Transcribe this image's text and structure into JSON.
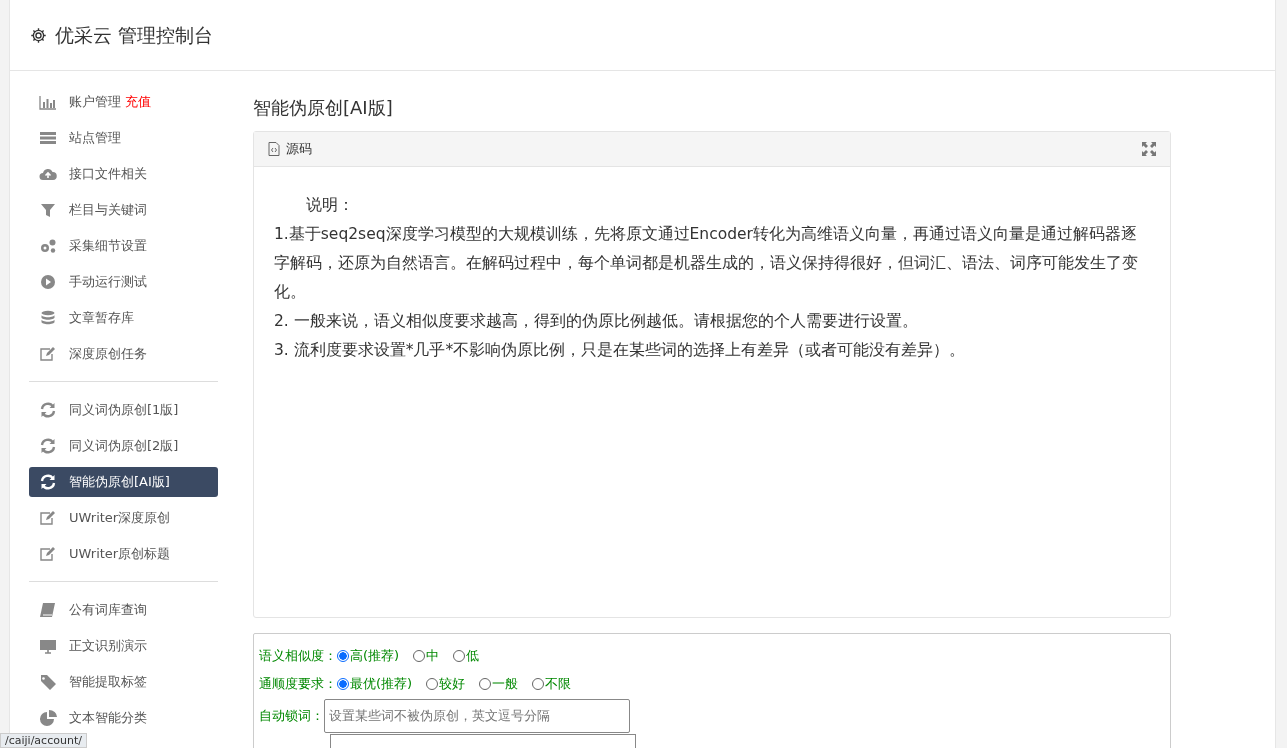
{
  "header": {
    "title": "优采云 管理控制台"
  },
  "sidebar": {
    "items": [
      {
        "kind": "item",
        "label": "账户管理",
        "badge": "充值",
        "selected": false
      },
      {
        "kind": "item",
        "label": "站点管理",
        "selected": false
      },
      {
        "kind": "item",
        "label": "接口文件相关",
        "selected": false
      },
      {
        "kind": "item",
        "label": "栏目与关键词",
        "selected": false
      },
      {
        "kind": "item",
        "label": "采集细节设置",
        "selected": false
      },
      {
        "kind": "item",
        "label": "手动运行测试",
        "selected": false
      },
      {
        "kind": "item",
        "label": "文章暂存库",
        "selected": false
      },
      {
        "kind": "item",
        "label": "深度原创任务",
        "selected": false
      },
      {
        "kind": "divider"
      },
      {
        "kind": "item",
        "label": "同义词伪原创[1版]",
        "selected": false
      },
      {
        "kind": "item",
        "label": "同义词伪原创[2版]",
        "selected": false
      },
      {
        "kind": "item",
        "label": "智能伪原创[AI版]",
        "selected": true
      },
      {
        "kind": "item",
        "label": "UWriter深度原创",
        "selected": false
      },
      {
        "kind": "item",
        "label": "UWriter原创标题",
        "selected": false
      },
      {
        "kind": "divider"
      },
      {
        "kind": "item",
        "label": "公有词库查询",
        "selected": false
      },
      {
        "kind": "item",
        "label": "正文识别演示",
        "selected": false
      },
      {
        "kind": "item",
        "label": "智能提取标签",
        "selected": false
      },
      {
        "kind": "item",
        "label": "文本智能分类",
        "selected": false
      }
    ]
  },
  "page_title": "智能伪原创[AI版]",
  "source_panel": {
    "tab": "源码",
    "paragraphs": [
      "说明：",
      "1.基于seq2seq深度学习模型的大规模训练，先将原文通过Encoder转化为高维语义向量，再通过语义向量是通过解码器逐字解码，还原为自然语言。在解码过程中，每个单词都是机器生成的，语义保持得很好，但词汇、语法、词序可能发生了变化。",
      "2. 一般来说，语义相似度要求越高，得到的伪原比例越低。请根据您的个人需要进行设置。",
      "3. 流利度要求设置*几乎*不影响伪原比例，只是在某些词的选择上有差异（或者可能没有差异）。"
    ]
  },
  "settings": {
    "radio_groups": [
      {
        "label": "语义相似度：",
        "options": [
          {
            "label": "高(推荐)",
            "selected": true
          },
          {
            "label": "中",
            "selected": false
          },
          {
            "label": "低",
            "selected": false
          }
        ]
      },
      {
        "label": "通顺度要求：",
        "options": [
          {
            "label": "最优(推荐)",
            "selected": true
          },
          {
            "label": "较好",
            "selected": false
          },
          {
            "label": "一般",
            "selected": false
          },
          {
            "label": "不限",
            "selected": false
          }
        ]
      }
    ],
    "lock_words": {
      "label": "自动锁词：",
      "placeholder": "设置某些词不被伪原创，英文逗号分隔"
    }
  },
  "status_url": "/caiji/account/"
}
